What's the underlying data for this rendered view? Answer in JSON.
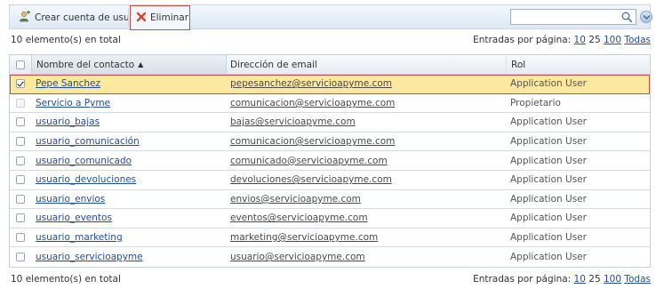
{
  "toolbar": {
    "create_label": "Crear cuenta de usuario",
    "create_icon": "add-user-icon",
    "delete_label": "Eliminar",
    "delete_icon": "delete-x-icon",
    "search_placeholder": "",
    "search_value": ""
  },
  "summary": {
    "total_text": "10 elemento(s) en total",
    "per_page_label": "Entradas por página:",
    "page_sizes": [
      "10",
      "25",
      "100"
    ],
    "all_label": "Todas"
  },
  "table": {
    "headers": {
      "name": "Nombre del contacto",
      "email": "Dirección de email",
      "role": "Rol"
    },
    "rows": [
      {
        "name": "Pepe Sanchez",
        "email": "pepesanchez@servicioapyme.com",
        "role": "Application User",
        "checked": true
      },
      {
        "name": "Servicio a Pyme",
        "email": "comunicacion@servicioapyme.com",
        "role": "Propietario",
        "checked": false
      },
      {
        "name": "usuario_bajas",
        "email": "bajas@servicioapyme.com",
        "role": "Application User",
        "checked": false
      },
      {
        "name": "usuario_comunicación",
        "email": "comunicacion@servicioapyme.com",
        "role": "Application User",
        "checked": false
      },
      {
        "name": "usuario_comunicado",
        "email": "comunicado@servicioapyme.com",
        "role": "Application User",
        "checked": false
      },
      {
        "name": "usuario_devoluciones",
        "email": "devoluciones@servicioapyme.com",
        "role": "Application User",
        "checked": false
      },
      {
        "name": "usuario_envios",
        "email": "envios@servicioapyme.com",
        "role": "Application User",
        "checked": false
      },
      {
        "name": "usuario_eventos",
        "email": "eventos@servicioapyme.com",
        "role": "Application User",
        "checked": false
      },
      {
        "name": "usuario_marketing",
        "email": "marketing@servicioapyme.com",
        "role": "Application User",
        "checked": false
      },
      {
        "name": "usuario_servicioapyme",
        "email": "usuario@servicioapyme.com",
        "role": "Application User",
        "checked": false
      }
    ]
  },
  "colors": {
    "selected_row": "#fde8a0",
    "selected_border": "#c0504d",
    "link": "#1f4e9c"
  }
}
